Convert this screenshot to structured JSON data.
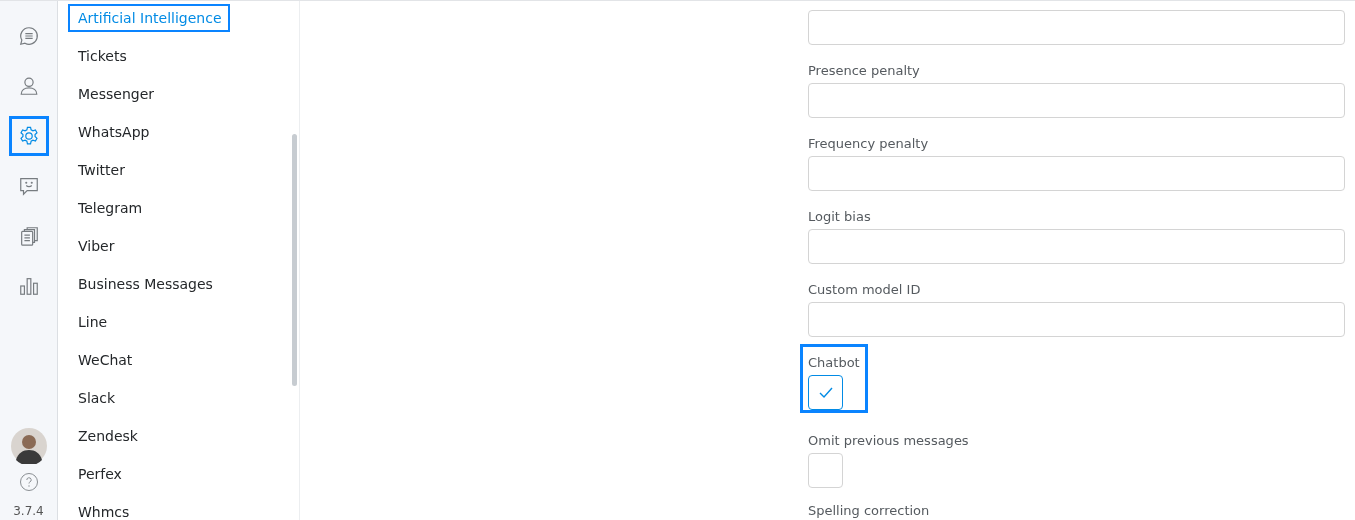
{
  "rail": {
    "items": [
      {
        "kind": "chat",
        "selected": false,
        "highlighted": false
      },
      {
        "kind": "user",
        "selected": false,
        "highlighted": false
      },
      {
        "kind": "settings",
        "selected": true,
        "highlighted": true
      },
      {
        "kind": "feedback",
        "selected": false,
        "highlighted": false
      },
      {
        "kind": "documents",
        "selected": false,
        "highlighted": false
      },
      {
        "kind": "reports",
        "selected": false,
        "highlighted": false
      }
    ],
    "version": "3.7.4"
  },
  "sidebar": {
    "items": [
      {
        "label": "Artificial Intelligence",
        "selected": true,
        "highlighted": true
      },
      {
        "label": "Tickets",
        "selected": false,
        "highlighted": false
      },
      {
        "label": "Messenger",
        "selected": false,
        "highlighted": false
      },
      {
        "label": "WhatsApp",
        "selected": false,
        "highlighted": false
      },
      {
        "label": "Twitter",
        "selected": false,
        "highlighted": false
      },
      {
        "label": "Telegram",
        "selected": false,
        "highlighted": false
      },
      {
        "label": "Viber",
        "selected": false,
        "highlighted": false
      },
      {
        "label": "Business Messages",
        "selected": false,
        "highlighted": false
      },
      {
        "label": "Line",
        "selected": false,
        "highlighted": false
      },
      {
        "label": "WeChat",
        "selected": false,
        "highlighted": false
      },
      {
        "label": "Slack",
        "selected": false,
        "highlighted": false
      },
      {
        "label": "Zendesk",
        "selected": false,
        "highlighted": false
      },
      {
        "label": "Perfex",
        "selected": false,
        "highlighted": false
      },
      {
        "label": "Whmcs",
        "selected": false,
        "highlighted": false
      }
    ]
  },
  "form": {
    "fields": [
      {
        "kind": "text"
      },
      {
        "kind": "text",
        "label": "Presence penalty"
      },
      {
        "kind": "text",
        "label": "Frequency penalty"
      },
      {
        "kind": "text",
        "label": "Logit bias"
      },
      {
        "kind": "text",
        "label": "Custom model ID"
      },
      {
        "kind": "checkbox",
        "label": "Chatbot",
        "checked": true,
        "highlighted": true
      },
      {
        "kind": "checkbox",
        "label": "Omit previous messages",
        "checked": false,
        "highlighted": false
      },
      {
        "kind": "heading",
        "label": "Spelling correction"
      }
    ]
  }
}
